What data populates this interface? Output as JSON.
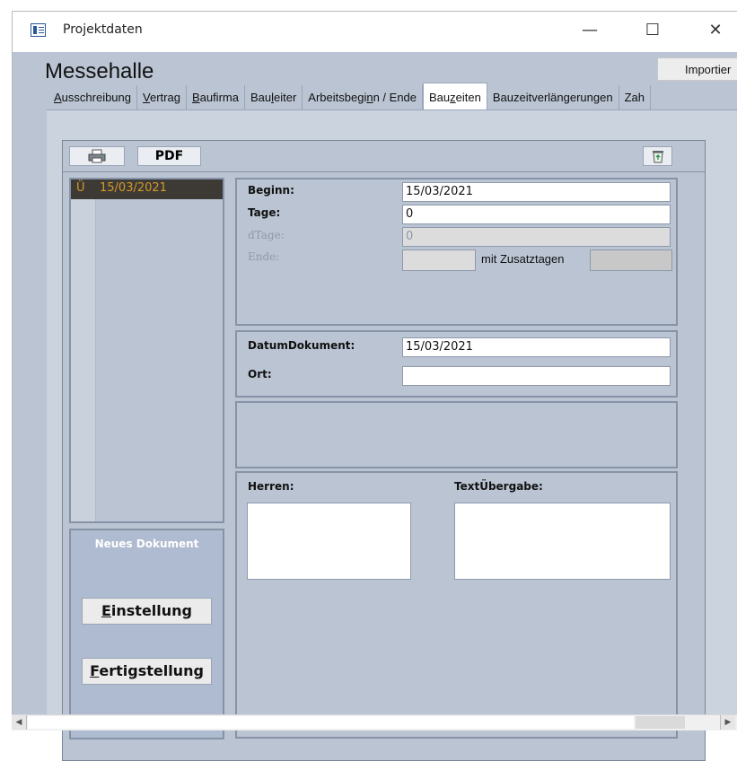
{
  "window": {
    "title": "Projektdaten",
    "minimize": "—",
    "maximize": "☐",
    "close": "✕"
  },
  "record": {
    "title": "Messehalle",
    "import_label": "Importier"
  },
  "tabs": [
    {
      "label": "Ausschreibung",
      "active": false
    },
    {
      "label": "Vertrag",
      "active": false
    },
    {
      "label": "Baufirma",
      "active": false
    },
    {
      "label": "Bauleiter",
      "active": false
    },
    {
      "label": "Arbeitsbeginn / Ende",
      "active": false
    },
    {
      "label": "Bauzeiten",
      "active": true
    },
    {
      "label": "Bauzeitverlängerungen",
      "active": false
    },
    {
      "label": "Zah",
      "active": false
    }
  ],
  "toolbar": {
    "print_icon": "printer-icon",
    "pdf_label": "PDF",
    "delete_icon": "recycle-bin-icon"
  },
  "doc_list": {
    "rows": [
      {
        "marker": "Ü",
        "date": "15/03/2021"
      }
    ]
  },
  "side_panel": {
    "new_doc_label": "Neues Dokument",
    "settings_label": "Einstellung",
    "finish_label": "Fertigstellung"
  },
  "dates": {
    "begin_label": "Beginn:",
    "begin_value": "15/03/2021",
    "days_label": "Tage:",
    "days_value": "0",
    "dtage_label": "dTage:",
    "dtage_value": "0",
    "end_label": "Ende:",
    "end_value": "",
    "extra_days_label": "mit Zusatztagen",
    "extra_days_value": ""
  },
  "document": {
    "date_label": "DatumDokument:",
    "date_value": "15/03/2021",
    "place_label": "Ort:",
    "place_value": ""
  },
  "text": {
    "herren_label": "Herren:",
    "herren_value": "",
    "handover_label": "TextÜbergabe:",
    "handover_value": ""
  },
  "scrollbar": {
    "left": "◀",
    "right": "▶"
  }
}
